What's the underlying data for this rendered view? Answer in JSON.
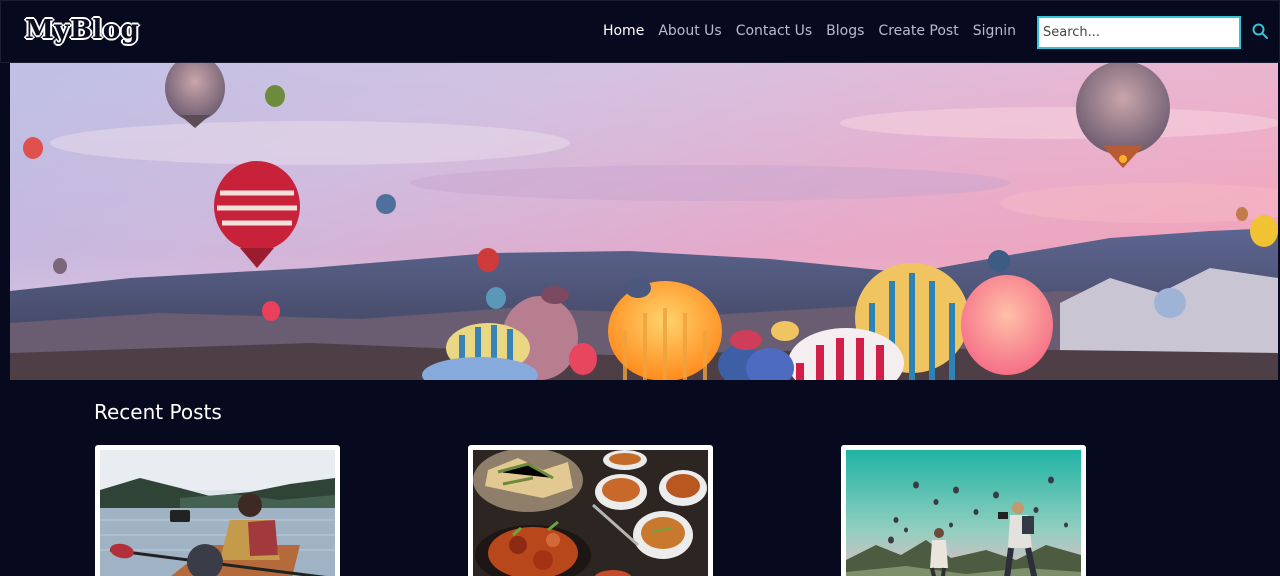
{
  "header": {
    "logo": "MyBlog",
    "nav": [
      {
        "label": "Home",
        "active": true
      },
      {
        "label": "About Us",
        "active": false
      },
      {
        "label": "Contact Us",
        "active": false
      },
      {
        "label": "Blogs",
        "active": false
      },
      {
        "label": "Create Post",
        "active": false
      },
      {
        "label": "Signin",
        "active": false
      }
    ],
    "search": {
      "placeholder": "Search...",
      "value": "",
      "icon": "search-icon"
    }
  },
  "hero": {
    "image": "hot-air-balloons-landscape"
  },
  "recent_posts": {
    "title": "Recent Posts",
    "posts": [
      {
        "image": "kayak-vlogger-lake"
      },
      {
        "image": "indian-food-spread"
      },
      {
        "image": "balloon-photographer-travel"
      }
    ]
  },
  "colors": {
    "background": "#070a1e",
    "accent": "#35c4d6",
    "nav_text": "#b7bccd"
  }
}
